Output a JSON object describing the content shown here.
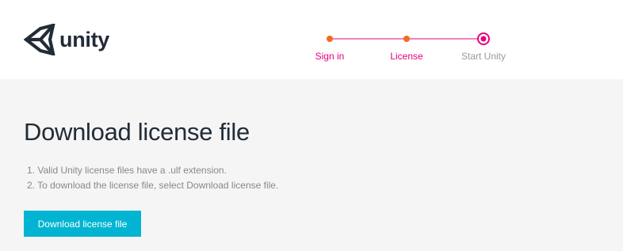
{
  "header": {
    "logo_text": "unity",
    "logo_icon": "unity-cube-icon"
  },
  "stepper": {
    "steps": [
      {
        "label": "Sign in",
        "status": "done"
      },
      {
        "label": "License",
        "status": "done"
      },
      {
        "label": "Start Unity",
        "status": "current"
      }
    ]
  },
  "main": {
    "title": "Download license file",
    "instructions": [
      "1. Valid Unity license files have a .ulf extension.",
      "2. To download the license file, select Download license file."
    ],
    "download_button_label": "Download license file"
  },
  "colors": {
    "accent": "#e5007e",
    "step_done_dot": "#f26b21",
    "button": "#00b4d2",
    "main_background": "#f5f5f5"
  }
}
